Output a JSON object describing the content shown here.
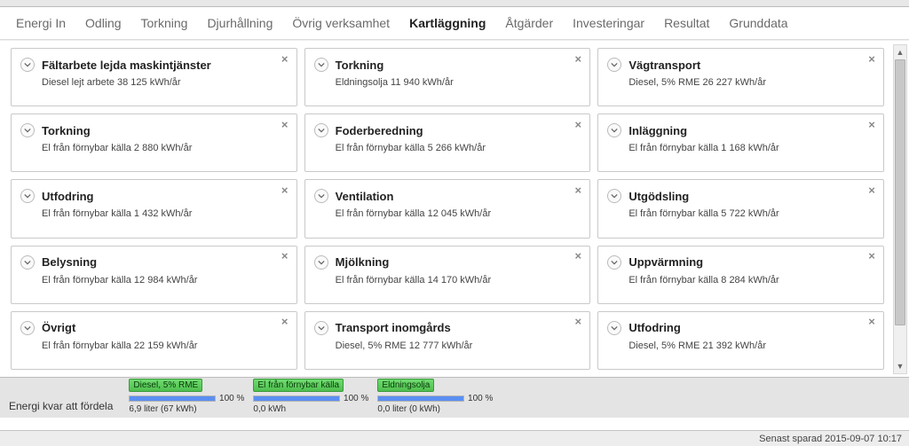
{
  "tabs": [
    {
      "label": "Energi In",
      "active": false
    },
    {
      "label": "Odling",
      "active": false
    },
    {
      "label": "Torkning",
      "active": false
    },
    {
      "label": "Djurhållning",
      "active": false
    },
    {
      "label": "Övrig verksamhet",
      "active": false
    },
    {
      "label": "Kartläggning",
      "active": true
    },
    {
      "label": "Åtgärder",
      "active": false
    },
    {
      "label": "Investeringar",
      "active": false
    },
    {
      "label": "Resultat",
      "active": false
    },
    {
      "label": "Grunddata",
      "active": false
    }
  ],
  "cards": [
    {
      "title": "Fältarbete lejda maskintjänster",
      "sub": "Diesel lejt arbete 38 125 kWh/år"
    },
    {
      "title": "Torkning",
      "sub": "Eldningsolja 11 940 kWh/år"
    },
    {
      "title": "Vägtransport",
      "sub": "Diesel, 5% RME 26 227 kWh/år"
    },
    {
      "title": "Torkning",
      "sub": "El från förnybar källa  2 880 kWh/år"
    },
    {
      "title": "Foderberedning",
      "sub": "El från förnybar källa  5 266 kWh/år"
    },
    {
      "title": "Inläggning",
      "sub": "El från förnybar källa  1 168 kWh/år"
    },
    {
      "title": "Utfodring",
      "sub": "El från förnybar källa  1 432 kWh/år"
    },
    {
      "title": "Ventilation",
      "sub": "El från förnybar källa  12 045 kWh/år"
    },
    {
      "title": "Utgödsling",
      "sub": "El från förnybar källa  5 722 kWh/år"
    },
    {
      "title": "Belysning",
      "sub": "El från förnybar källa  12 984 kWh/år"
    },
    {
      "title": "Mjölkning",
      "sub": "El från förnybar källa  14 170 kWh/år"
    },
    {
      "title": "Uppvärmning",
      "sub": "El från förnybar källa  8 284 kWh/år"
    },
    {
      "title": "Övrigt",
      "sub": "El från förnybar källa  22 159 kWh/år"
    },
    {
      "title": "Transport inomgårds",
      "sub": "Diesel, 5% RME 12 777 kWh/år"
    },
    {
      "title": "Utfodring",
      "sub": "Diesel, 5% RME 21 392 kWh/år"
    }
  ],
  "footer": {
    "label": "Energi kvar att fördela",
    "gauges": [
      {
        "name": "Diesel, 5% RME",
        "pct": "100 %",
        "fill": 100,
        "sub": "6,9 liter  (67 kWh)"
      },
      {
        "name": "El från förnybar källa",
        "pct": "100 %",
        "fill": 100,
        "sub": "0,0 kWh"
      },
      {
        "name": "Eldningsolja",
        "pct": "100 %",
        "fill": 100,
        "sub": "0,0 liter  (0 kWh)"
      }
    ]
  },
  "status": "Senast sparad 2015-09-07 10:17"
}
